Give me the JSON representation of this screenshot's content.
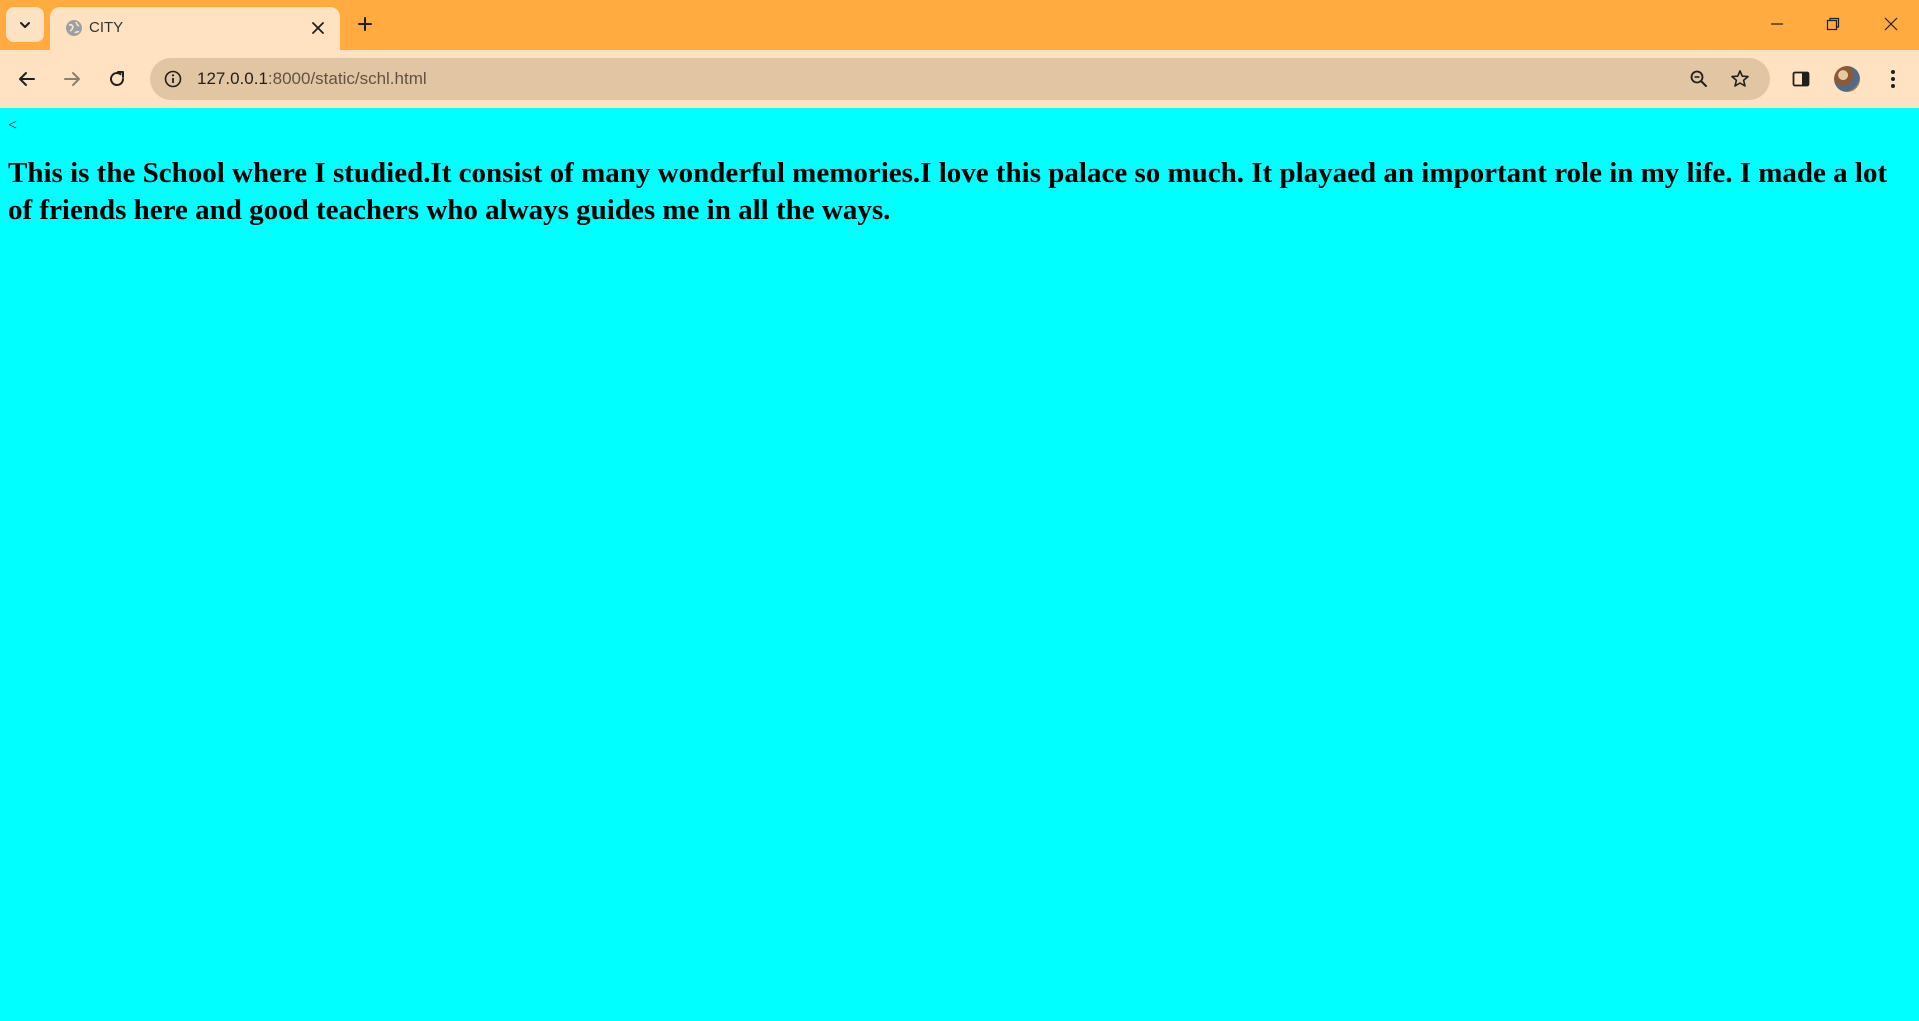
{
  "browser": {
    "tab": {
      "title": "CITY",
      "favicon": "globe-icon"
    },
    "address_bar": {
      "host": "127.0.0.1",
      "path": ":8000/static/schl.html"
    },
    "colors": {
      "frame": "#ffab40",
      "toolbar": "#ffe2c2",
      "omnibox": "#e2c6a4"
    }
  },
  "page": {
    "background": "#00ffff",
    "back_link": "<",
    "heading": "This is the School where I studied.It consist of many wonderful memories.I love this palace so much. It playaed an important role in my life. I made a lot of friends here and good teachers who always guides me in all the ways."
  }
}
